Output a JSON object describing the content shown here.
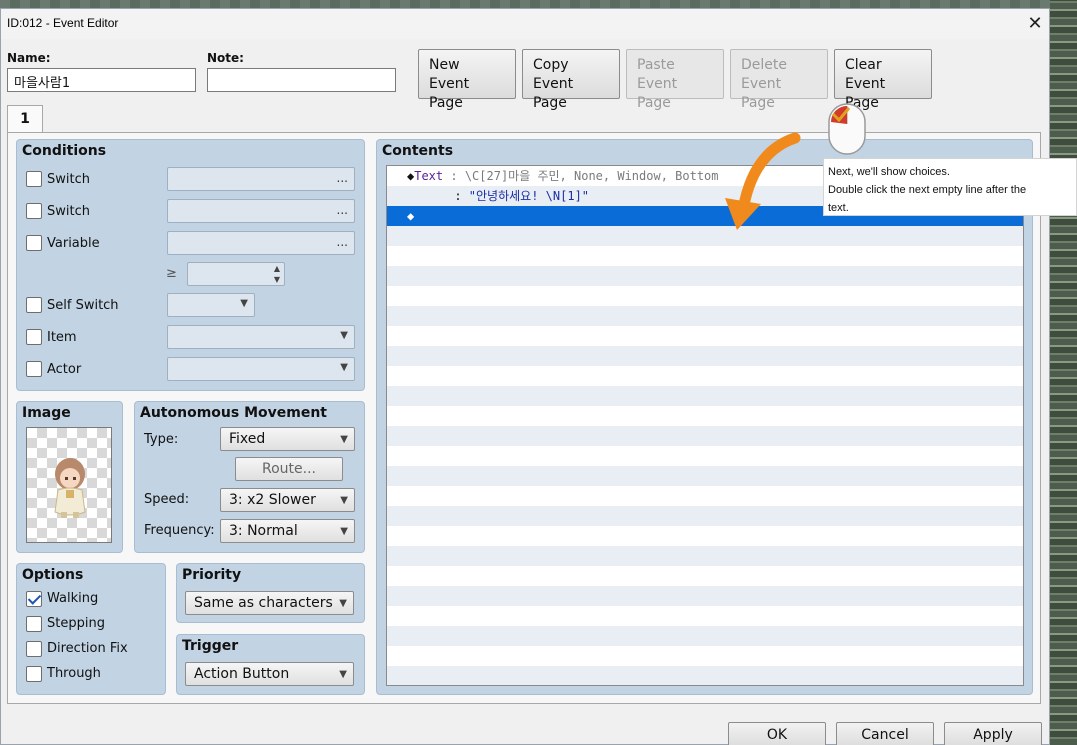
{
  "window": {
    "title": "ID:012 - Event Editor",
    "close": "✕"
  },
  "header": {
    "name_label": "Name:",
    "name_value": "마을사람1",
    "note_label": "Note:",
    "note_value": ""
  },
  "toolbar": {
    "new_page": "New\nEvent Page",
    "copy_page": "Copy\nEvent Page",
    "paste_page": "Paste\nEvent Page",
    "delete_page": "Delete\nEvent Page",
    "clear_page": "Clear\nEvent Page"
  },
  "tabs": [
    {
      "label": "1"
    }
  ],
  "conditions": {
    "title": "Conditions",
    "switch1": "Switch",
    "switch2": "Switch",
    "variable": "Variable",
    "ge": "≥",
    "self_switch": "Self Switch",
    "item": "Item",
    "actor": "Actor",
    "dots": "..."
  },
  "image": {
    "title": "Image"
  },
  "movement": {
    "title": "Autonomous Movement",
    "type_label": "Type:",
    "type_value": "Fixed",
    "route_button": "Route...",
    "speed_label": "Speed:",
    "speed_value": "3: x2 Slower",
    "frequency_label": "Frequency:",
    "frequency_value": "3: Normal"
  },
  "options": {
    "title": "Options",
    "walking": "Walking",
    "stepping": "Stepping",
    "direction_fix": "Direction Fix",
    "through": "Through"
  },
  "priority": {
    "title": "Priority",
    "value": "Same as characters"
  },
  "trigger": {
    "title": "Trigger",
    "value": "Action Button"
  },
  "contents": {
    "title": "Contents",
    "line1": {
      "marker": "◆",
      "kw": "Text",
      "sep": " : ",
      "params": "\\C[27]마을 주민, None, Window, Bottom"
    },
    "line2": {
      "marker": "",
      "lead": "    :",
      "colon": "      : ",
      "text": "\"안녕하세요! \\N[1]\""
    },
    "line3": {
      "marker": "◆"
    }
  },
  "tooltip": {
    "line1": "Next, we'll show choices.",
    "line2": "Double click the next empty line after the",
    "line3": "text."
  },
  "footer": {
    "ok": "OK",
    "cancel": "Cancel",
    "apply": "Apply"
  },
  "colors": {
    "group_bg": "#c2d3e4",
    "selection": "#0a6cd6",
    "arrow": "#f08a1c"
  }
}
